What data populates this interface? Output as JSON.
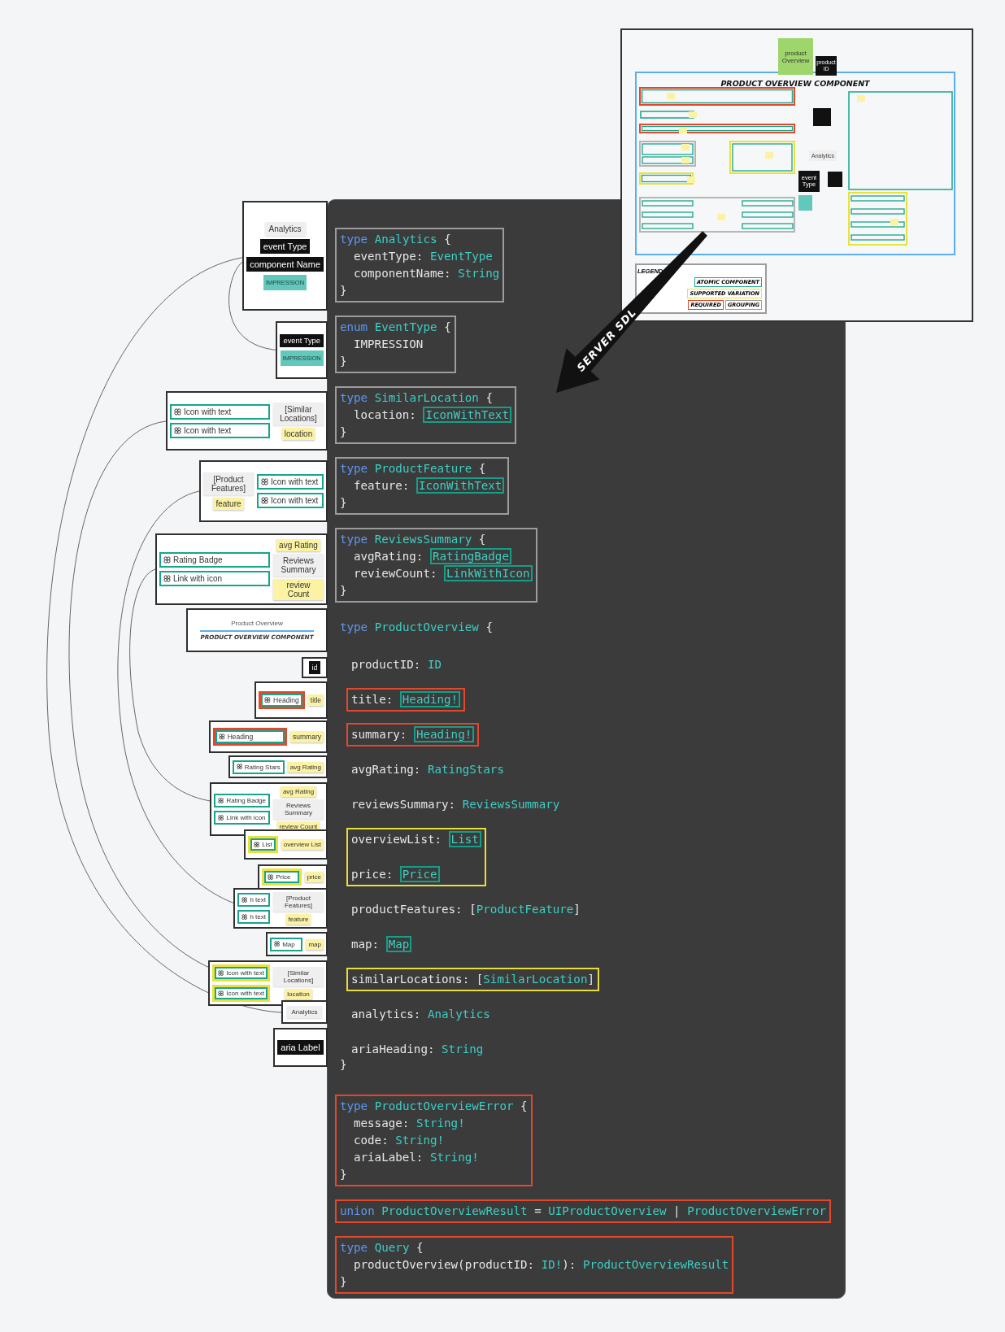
{
  "inset": {
    "sticky": "product Overview",
    "id_note": "product ID",
    "title": "PRODUCT OVERVIEW COMPONENT",
    "analytics_label": "Analytics",
    "event_note": "event Type",
    "legend": {
      "title": "LEGEND",
      "tags": [
        {
          "text": "ATOMIC COMPONENT",
          "kind": "atomic"
        },
        {
          "text": "SUPPORTED VARIATION",
          "kind": "variation"
        },
        {
          "text": "REQUIRED",
          "kind": "required"
        },
        {
          "text": "GROUPING",
          "kind": "grouping"
        }
      ]
    }
  },
  "arrow": {
    "label": "SERVER SDL"
  },
  "code_panel": {
    "blocks": [
      {
        "kind": "group",
        "lines": [
          {
            "indent": false,
            "words": [
              [
                {
                  "text": "type",
                  "kind": "keyword"
                }
              ],
              [
                {
                  "text": "Analytics",
                  "kind": "name"
                }
              ],
              [
                {
                  "text": "{",
                  "kind": "text"
                }
              ]
            ]
          },
          {
            "indent": true,
            "words": [
              [
                {
                  "text": "eventType:",
                  "kind": "text"
                }
              ],
              [
                {
                  "text": "EventType",
                  "kind": "name"
                }
              ]
            ]
          },
          {
            "indent": true,
            "words": [
              [
                {
                  "text": "componentName:",
                  "kind": "text"
                }
              ],
              [
                {
                  "text": "String",
                  "kind": "name"
                }
              ]
            ]
          },
          {
            "indent": false,
            "words": [
              [
                {
                  "text": "}",
                  "kind": "text"
                }
              ]
            ]
          }
        ]
      },
      {
        "kind": "group",
        "lines": [
          {
            "indent": false,
            "words": [
              [
                {
                  "text": "enum",
                  "kind": "keyword"
                }
              ],
              [
                {
                  "text": "EventType",
                  "kind": "name"
                }
              ],
              [
                {
                  "text": "{",
                  "kind": "text"
                }
              ]
            ]
          },
          {
            "indent": true,
            "words": [
              [
                {
                  "text": "IMPRESSION",
                  "kind": "text"
                }
              ]
            ]
          },
          {
            "indent": false,
            "words": [
              [
                {
                  "text": "}",
                  "kind": "text"
                }
              ]
            ]
          }
        ]
      },
      {
        "kind": "group",
        "lines": [
          {
            "indent": false,
            "words": [
              [
                {
                  "text": "type",
                  "kind": "keyword"
                }
              ],
              [
                {
                  "text": "SimilarLocation",
                  "kind": "name"
                }
              ],
              [
                {
                  "text": "{",
                  "kind": "text"
                }
              ]
            ]
          },
          {
            "indent": true,
            "words": [
              [
                {
                  "text": "location:",
                  "kind": "text"
                }
              ],
              [
                {
                  "text": "IconWithText",
                  "kind": "ref"
                }
              ]
            ]
          },
          {
            "indent": false,
            "words": [
              [
                {
                  "text": "}",
                  "kind": "text"
                }
              ]
            ]
          }
        ]
      },
      {
        "kind": "group",
        "lines": [
          {
            "indent": false,
            "words": [
              [
                {
                  "text": "type",
                  "kind": "keyword"
                }
              ],
              [
                {
                  "text": "ProductFeature",
                  "kind": "name"
                }
              ],
              [
                {
                  "text": "{",
                  "kind": "text"
                }
              ]
            ]
          },
          {
            "indent": true,
            "words": [
              [
                {
                  "text": "feature:",
                  "kind": "text"
                }
              ],
              [
                {
                  "text": "IconWithText",
                  "kind": "ref"
                }
              ]
            ]
          },
          {
            "indent": false,
            "words": [
              [
                {
                  "text": "}",
                  "kind": "text"
                }
              ]
            ]
          }
        ]
      },
      {
        "kind": "group",
        "lines": [
          {
            "indent": false,
            "words": [
              [
                {
                  "text": "type",
                  "kind": "keyword"
                }
              ],
              [
                {
                  "text": "ReviewsSummary",
                  "kind": "name"
                }
              ],
              [
                {
                  "text": "{",
                  "kind": "text"
                }
              ]
            ]
          },
          {
            "indent": true,
            "words": [
              [
                {
                  "text": "avgRating:",
                  "kind": "text"
                }
              ],
              [
                {
                  "text": "RatingBadge",
                  "kind": "ref"
                }
              ]
            ]
          },
          {
            "indent": true,
            "words": [
              [
                {
                  "text": "reviewCount:",
                  "kind": "text"
                }
              ],
              [
                {
                  "text": "LinkWithIcon",
                  "kind": "ref"
                }
              ]
            ]
          },
          {
            "indent": false,
            "words": [
              [
                {
                  "text": "}",
                  "kind": "text"
                }
              ]
            ]
          }
        ]
      },
      {
        "kind": "plain",
        "lines": [
          {
            "indent": false,
            "words": [
              [
                {
                  "text": "type",
                  "kind": "keyword"
                }
              ],
              [
                {
                  "text": "ProductOverview",
                  "kind": "name"
                }
              ],
              [
                {
                  "text": "{",
                  "kind": "text"
                }
              ]
            ]
          }
        ]
      },
      {
        "kind": "field",
        "lines": [
          {
            "indent": false,
            "words": [
              [
                {
                  "text": "productID:",
                  "kind": "text"
                }
              ],
              [
                {
                  "text": "ID",
                  "kind": "name"
                }
              ]
            ]
          }
        ]
      },
      {
        "kind": "required-field",
        "lines": [
          {
            "indent": false,
            "words": [
              [
                {
                  "text": "title:",
                  "kind": "text"
                }
              ],
              [
                {
                  "text": "Heading!",
                  "kind": "ref"
                }
              ]
            ]
          }
        ]
      },
      {
        "kind": "required-field",
        "lines": [
          {
            "indent": false,
            "words": [
              [
                {
                  "text": "summary:",
                  "kind": "text"
                }
              ],
              [
                {
                  "text": "Heading!",
                  "kind": "ref"
                }
              ]
            ]
          }
        ]
      },
      {
        "kind": "field",
        "lines": [
          {
            "indent": false,
            "words": [
              [
                {
                  "text": "avgRating:",
                  "kind": "text"
                }
              ],
              [
                {
                  "text": "RatingStars",
                  "kind": "name"
                }
              ]
            ]
          }
        ]
      },
      {
        "kind": "field",
        "lines": [
          {
            "indent": false,
            "words": [
              [
                {
                  "text": "reviewsSummary:",
                  "kind": "text"
                }
              ],
              [
                {
                  "text": "ReviewsSummary",
                  "kind": "name"
                }
              ]
            ]
          }
        ]
      },
      {
        "kind": "variation-field",
        "lines": [
          {
            "indent": false,
            "words": [
              [
                {
                  "text": "overviewList:",
                  "kind": "text"
                }
              ],
              [
                {
                  "text": "List",
                  "kind": "ref"
                }
              ]
            ]
          },
          {
            "indent": false,
            "words": [
              [
                {
                  "text": "price:",
                  "kind": "text"
                }
              ],
              [
                {
                  "text": "Price",
                  "kind": "ref"
                }
              ]
            ]
          }
        ]
      },
      {
        "kind": "field",
        "lines": [
          {
            "indent": false,
            "words": [
              [
                {
                  "text": "productFeatures:",
                  "kind": "text"
                }
              ],
              [
                {
                  "text": "[",
                  "kind": "text"
                },
                {
                  "text": "ProductFeature",
                  "kind": "name"
                },
                {
                  "text": "]",
                  "kind": "text"
                }
              ]
            ]
          }
        ]
      },
      {
        "kind": "field",
        "lines": [
          {
            "indent": false,
            "words": [
              [
                {
                  "text": "map:",
                  "kind": "text"
                }
              ],
              [
                {
                  "text": "Map",
                  "kind": "ref"
                }
              ]
            ]
          }
        ]
      },
      {
        "kind": "variation-field",
        "lines": [
          {
            "indent": false,
            "words": [
              [
                {
                  "text": "similarLocations:",
                  "kind": "text"
                }
              ],
              [
                {
                  "text": "[",
                  "kind": "text"
                },
                {
                  "text": "SimilarLocation",
                  "kind": "name"
                },
                {
                  "text": "]",
                  "kind": "text"
                }
              ]
            ]
          }
        ]
      },
      {
        "kind": "field",
        "lines": [
          {
            "indent": false,
            "words": [
              [
                {
                  "text": "analytics:",
                  "kind": "text"
                }
              ],
              [
                {
                  "text": "Analytics",
                  "kind": "name"
                }
              ]
            ]
          }
        ]
      },
      {
        "kind": "field",
        "lines": [
          {
            "indent": false,
            "words": [
              [
                {
                  "text": "ariaHeading:",
                  "kind": "text"
                }
              ],
              [
                {
                  "text": "String",
                  "kind": "name"
                }
              ]
            ]
          }
        ]
      },
      {
        "kind": "plain",
        "lines": [
          {
            "indent": false,
            "words": [
              [
                {
                  "text": "}",
                  "kind": "text"
                }
              ]
            ]
          }
        ]
      },
      {
        "kind": "required",
        "lines": [
          {
            "indent": false,
            "words": [
              [
                {
                  "text": "type",
                  "kind": "keyword"
                }
              ],
              [
                {
                  "text": "ProductOverviewError",
                  "kind": "name"
                }
              ],
              [
                {
                  "text": "{",
                  "kind": "text"
                }
              ]
            ]
          },
          {
            "indent": true,
            "words": [
              [
                {
                  "text": "message:",
                  "kind": "text"
                }
              ],
              [
                {
                  "text": "String!",
                  "kind": "name"
                }
              ]
            ]
          },
          {
            "indent": true,
            "words": [
              [
                {
                  "text": "code:",
                  "kind": "text"
                }
              ],
              [
                {
                  "text": "String!",
                  "kind": "name"
                }
              ]
            ]
          },
          {
            "indent": true,
            "words": [
              [
                {
                  "text": "ariaLabel:",
                  "kind": "text"
                }
              ],
              [
                {
                  "text": "String!",
                  "kind": "name"
                }
              ]
            ]
          },
          {
            "indent": false,
            "words": [
              [
                {
                  "text": "}",
                  "kind": "text"
                }
              ]
            ]
          }
        ]
      },
      {
        "kind": "required",
        "lines": [
          {
            "indent": false,
            "words": [
              [
                {
                  "text": "union",
                  "kind": "keyword"
                }
              ],
              [
                {
                  "text": "ProductOverviewResult",
                  "kind": "name"
                }
              ],
              [
                {
                  "text": "=",
                  "kind": "text"
                }
              ],
              [
                {
                  "text": "UIProductOverview",
                  "kind": "name"
                }
              ],
              [
                {
                  "text": "|",
                  "kind": "text"
                }
              ],
              [
                {
                  "text": "ProductOverviewError",
                  "kind": "name"
                }
              ]
            ]
          }
        ]
      },
      {
        "kind": "required",
        "lines": [
          {
            "indent": false,
            "words": [
              [
                {
                  "text": "type",
                  "kind": "keyword"
                }
              ],
              [
                {
                  "text": "Query",
                  "kind": "name"
                }
              ],
              [
                {
                  "text": "{",
                  "kind": "text"
                }
              ]
            ]
          },
          {
            "indent": true,
            "words": [
              [
                {
                  "text": "productOverview(productID:",
                  "kind": "text"
                }
              ],
              [
                {
                  "text": "ID!",
                  "kind": "name"
                },
                {
                  "text": "):",
                  "kind": "text"
                }
              ],
              [
                {
                  "text": "ProductOverviewResult",
                  "kind": "name"
                }
              ]
            ]
          },
          {
            "indent": false,
            "words": [
              [
                {
                  "text": "}",
                  "kind": "text"
                }
              ]
            ]
          }
        ]
      }
    ]
  },
  "thumbnails": [
    {
      "items": [
        {
          "kind": "label",
          "text": "Analytics"
        },
        {
          "kind": "note",
          "text": "event Type"
        },
        {
          "kind": "note",
          "text": "component Name"
        },
        {
          "kind": "enum",
          "text": "IMPRESSION"
        }
      ]
    },
    {
      "items": [
        {
          "kind": "note",
          "text": "event Type"
        },
        {
          "kind": "enum",
          "text": "IMPRESSION"
        }
      ]
    },
    {
      "items": [
        {
          "kind": "component",
          "text": "Icon with text"
        },
        {
          "kind": "component",
          "text": "Icon with text"
        },
        {
          "kind": "label",
          "text": "[Similar Locations]"
        },
        {
          "kind": "sticky",
          "text": "location"
        }
      ]
    },
    {
      "items": [
        {
          "kind": "label",
          "text": "[Product Features]"
        },
        {
          "kind": "sticky",
          "text": "feature"
        },
        {
          "kind": "component",
          "text": "Icon with text"
        },
        {
          "kind": "component",
          "text": "Icon with text"
        }
      ]
    },
    {
      "items": [
        {
          "kind": "component",
          "text": "Rating Badge"
        },
        {
          "kind": "component",
          "text": "Link with icon"
        },
        {
          "kind": "sticky",
          "text": "avg Rating"
        },
        {
          "kind": "label",
          "text": "Reviews Summary"
        },
        {
          "kind": "sticky",
          "text": "review Count"
        }
      ]
    },
    {
      "items": [
        {
          "kind": "caption",
          "text": "Product Overview"
        },
        {
          "kind": "banner",
          "text": "PRODUCT OVERVIEW COMPONENT"
        }
      ]
    },
    {
      "items": [
        {
          "kind": "note",
          "text": "id"
        }
      ]
    },
    {
      "items": [
        {
          "kind": "required-component",
          "text": "Heading"
        },
        {
          "kind": "sticky",
          "text": "title"
        }
      ]
    },
    {
      "items": [
        {
          "kind": "required-component",
          "text": "Heading"
        },
        {
          "kind": "sticky",
          "text": "summary"
        }
      ]
    },
    {
      "items": [
        {
          "kind": "component",
          "text": "Rating Stars"
        },
        {
          "kind": "sticky",
          "text": "avg Rating"
        }
      ]
    },
    {
      "items": [
        {
          "kind": "component",
          "text": "Rating Badge"
        },
        {
          "kind": "component",
          "text": "Link with icon"
        },
        {
          "kind": "sticky",
          "text": "avg Rating"
        },
        {
          "kind": "label",
          "text": "Reviews Summary"
        },
        {
          "kind": "sticky",
          "text": "review Count"
        }
      ]
    },
    {
      "items": [
        {
          "kind": "variation-component",
          "text": "List"
        },
        {
          "kind": "sticky",
          "text": "overview List"
        }
      ]
    },
    {
      "items": [
        {
          "kind": "variation-component",
          "text": "Price"
        },
        {
          "kind": "sticky",
          "text": "price"
        }
      ]
    },
    {
      "items": [
        {
          "kind": "component",
          "text": "h text"
        },
        {
          "kind": "component",
          "text": "h text"
        },
        {
          "kind": "label",
          "text": "[Product Features]"
        },
        {
          "kind": "sticky",
          "text": "feature"
        }
      ]
    },
    {
      "items": [
        {
          "kind": "component",
          "text": "Map"
        },
        {
          "kind": "sticky",
          "text": "map"
        }
      ]
    },
    {
      "items": [
        {
          "kind": "variation-component",
          "text": "Icon with text"
        },
        {
          "kind": "variation-component",
          "text": "Icon with text"
        },
        {
          "kind": "label",
          "text": "[Similar Locations]"
        },
        {
          "kind": "sticky",
          "text": "location"
        }
      ]
    },
    {
      "items": [
        {
          "kind": "label",
          "text": "Analytics"
        }
      ]
    },
    {
      "items": [
        {
          "kind": "note",
          "text": "aria Label"
        }
      ]
    }
  ]
}
